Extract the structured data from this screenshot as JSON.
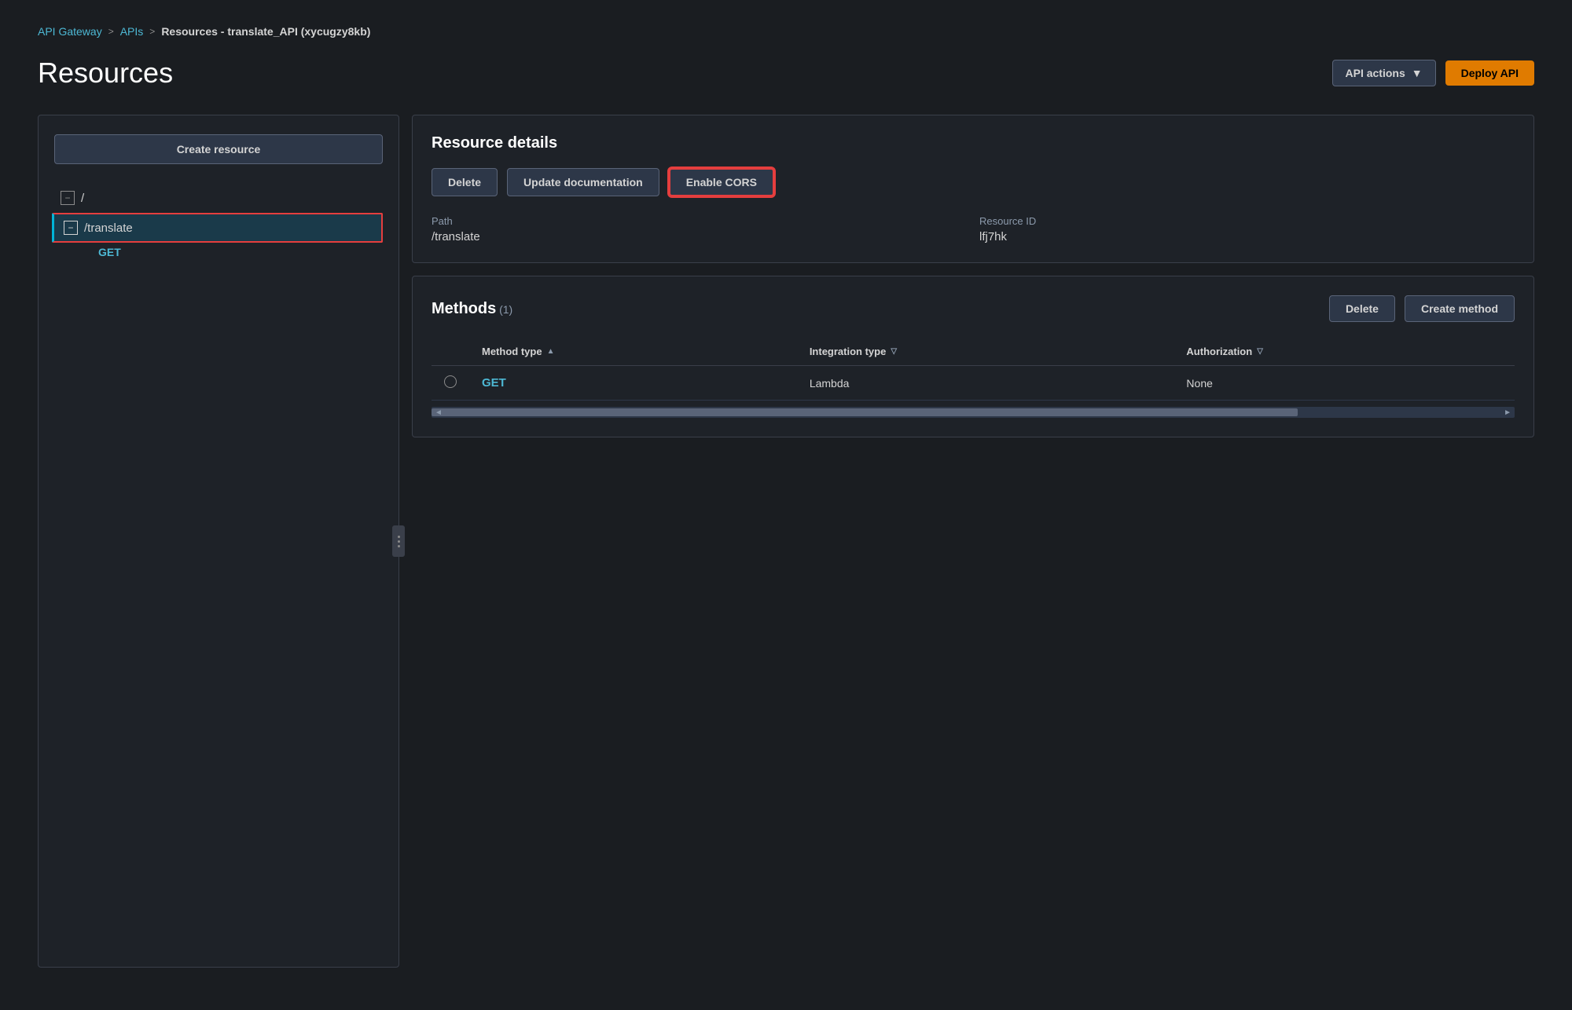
{
  "breadcrumb": {
    "api_gateway": "API Gateway",
    "apis": "APIs",
    "current": "Resources - translate_API (xycugzy8kb)"
  },
  "page_title": "Resources",
  "header": {
    "api_actions_label": "API actions",
    "deploy_api_label": "Deploy API"
  },
  "left_panel": {
    "create_resource_label": "Create resource",
    "tree": {
      "root_label": "/",
      "translate_label": "/translate",
      "get_label": "GET"
    }
  },
  "resource_details": {
    "title": "Resource details",
    "delete_label": "Delete",
    "update_docs_label": "Update documentation",
    "enable_cors_label": "Enable CORS",
    "path_label": "Path",
    "path_value": "/translate",
    "resource_id_label": "Resource ID",
    "resource_id_value": "lfj7hk"
  },
  "methods": {
    "title": "Methods",
    "count": "(1)",
    "delete_label": "Delete",
    "create_method_label": "Create method",
    "columns": {
      "method_type": "Method type",
      "integration_type": "Integration type",
      "authorization": "Authorization"
    },
    "rows": [
      {
        "method": "GET",
        "integration": "Lambda",
        "authorization": "None"
      }
    ]
  },
  "icons": {
    "chevron_down": "▼",
    "arrow_right": ">",
    "sort_asc": "▲",
    "sort_desc": "▽",
    "minus": "−",
    "expand": "⊟"
  }
}
